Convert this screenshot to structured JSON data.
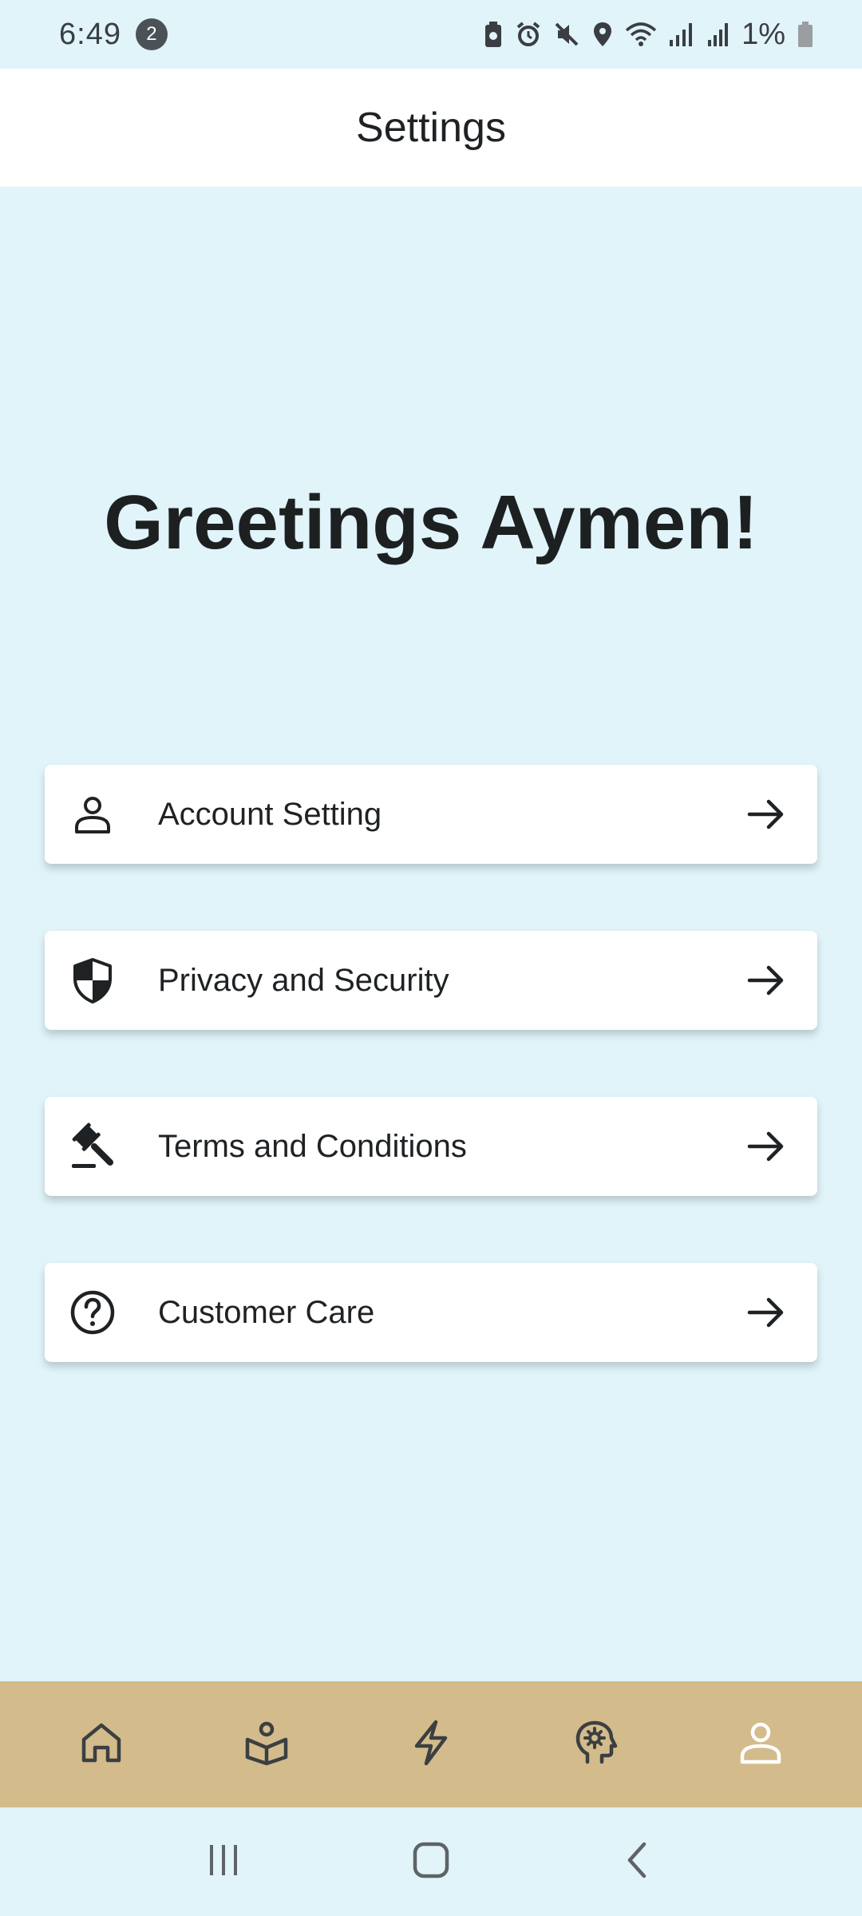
{
  "status_bar": {
    "time": "6:49",
    "notification_count": "2",
    "battery": "1%"
  },
  "app_bar": {
    "title": "Settings"
  },
  "greeting": "Greetings Aymen!",
  "menu": [
    {
      "label": "Account Setting",
      "icon": "person-icon"
    },
    {
      "label": "Privacy and Security",
      "icon": "shield-icon"
    },
    {
      "label": "Terms and Conditions",
      "icon": "gavel-icon"
    },
    {
      "label": "Customer Care",
      "icon": "help-circle-icon"
    }
  ],
  "bottom_nav": [
    {
      "icon": "home-icon",
      "active": false
    },
    {
      "icon": "learning-icon",
      "active": false
    },
    {
      "icon": "lightning-icon",
      "active": false
    },
    {
      "icon": "mind-gear-icon",
      "active": false
    },
    {
      "icon": "profile-icon",
      "active": true
    }
  ],
  "colors": {
    "background": "#e0f4fa",
    "app_bar": "#ffffff",
    "card": "#ffffff",
    "bottom_nav": "#d4bb8b",
    "text": "#1f2224",
    "nav_icon": "#3b3f42",
    "nav_icon_active": "#ffffff"
  }
}
